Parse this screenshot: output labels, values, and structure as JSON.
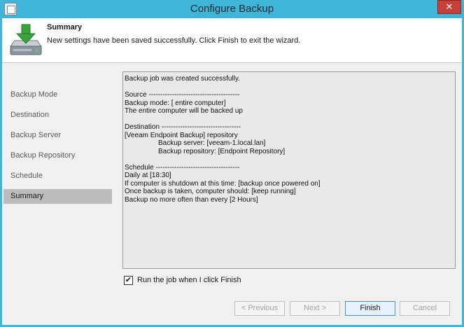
{
  "window": {
    "title": "Configure Backup",
    "close_glyph": "✕"
  },
  "header": {
    "title": "Summary",
    "subtitle": "New settings have been saved successfully. Click Finish to exit the wizard."
  },
  "sidebar": {
    "items": [
      {
        "label": "Backup Mode"
      },
      {
        "label": "Destination"
      },
      {
        "label": "Backup Server"
      },
      {
        "label": "Backup Repository"
      },
      {
        "label": "Schedule"
      },
      {
        "label": "Summary"
      }
    ],
    "active_index": 5
  },
  "summary": {
    "lines": [
      "Backup job was created successfully.",
      "",
      "Source ---------------------------------------",
      "Backup mode: [ entire computer]",
      "The entire computer will be backed up",
      "",
      "Destination ----------------------------------",
      "[Veeam Endpoint Backup] repository",
      "Backup server: [veeam-1.local.lan]",
      "Backup repository: [Endpoint Repository]",
      "",
      "Schedule ------------------------------------",
      "Daily at [18:30]",
      "If computer is shutdown at this time: [backup once powered on]",
      "Once backup is taken, computer should: [keep running]",
      "Backup no more often than every [2 Hours]"
    ],
    "indented_lines": [
      8,
      9
    ]
  },
  "options": {
    "run_label": "Run the job when I click Finish",
    "run_checked": true,
    "check_glyph": "✔"
  },
  "buttons": {
    "previous": "< Previous",
    "next": "Next >",
    "finish": "Finish",
    "cancel": "Cancel"
  },
  "colors": {
    "titlebar": "#3fb5d8",
    "close": "#c7413a",
    "active_nav": "#bcbcbc",
    "arrow_green": "#3aa23a"
  }
}
